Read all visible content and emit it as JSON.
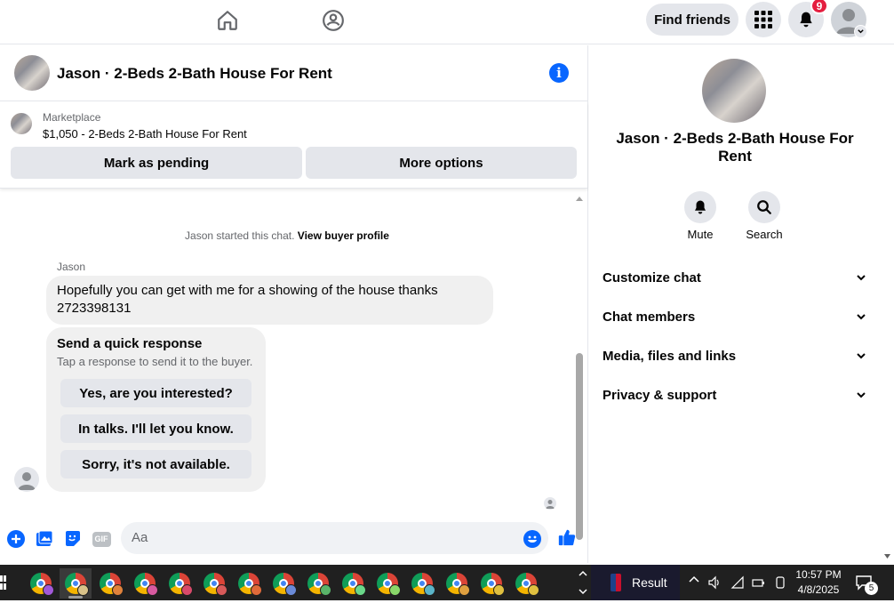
{
  "topbar": {
    "find_friends_label": "Find friends",
    "notification_count": "9"
  },
  "chat_header": {
    "title": "Jason · 2-Beds 2-Bath House For Rent"
  },
  "marketplace": {
    "label": "Marketplace",
    "price_title": "$1,050 - 2-Beds 2-Bath House For Rent",
    "mark_pending_label": "Mark as pending",
    "more_options_label": "More options"
  },
  "messages": {
    "system_text": "Jason started this chat.",
    "view_buyer_profile_label": "View buyer profile",
    "sender_name": "Jason",
    "message_line1": "Hopefully you can get with me for a showing of the house thanks",
    "message_line2": "2723398131",
    "quick_response": {
      "title": "Send a quick response",
      "subtitle": "Tap a response to send it to the buyer.",
      "options": [
        "Yes, are you interested?",
        "In talks. I'll let you know.",
        "Sorry, it's not available."
      ]
    }
  },
  "composer": {
    "placeholder": "Aa",
    "icons": [
      "plus-circle-icon",
      "photo-icon",
      "sticker-icon",
      "gif-icon",
      "emoji-icon",
      "thumbs-up-icon"
    ],
    "gif_label": "GIF"
  },
  "info_panel": {
    "title": "Jason · 2-Beds 2-Bath House For Rent",
    "mute_label": "Mute",
    "search_label": "Search",
    "sections": [
      "Customize chat",
      "Chat members",
      "Media, files and links",
      "Privacy & support"
    ]
  },
  "taskbar": {
    "chrome_profile_colors": [
      "#a259d9",
      "#d9c28a",
      "#e0823c",
      "#d85aa0",
      "#d84a6a",
      "#d85a5a",
      "#e06a3a",
      "#6a8ad8",
      "#5ab46a",
      "#6ad88a",
      "#8ad86a",
      "#5ab4c8",
      "#e0a040",
      "#e0c040",
      "#e0c040"
    ],
    "result_label": "Result",
    "time": "10:57 PM",
    "date": "4/8/2025",
    "notification_count": "5"
  },
  "colors": {
    "accent": "#0866ff",
    "badge": "#e41e3f",
    "bubble": "#f0f0f0",
    "button": "#e4e6eb"
  }
}
